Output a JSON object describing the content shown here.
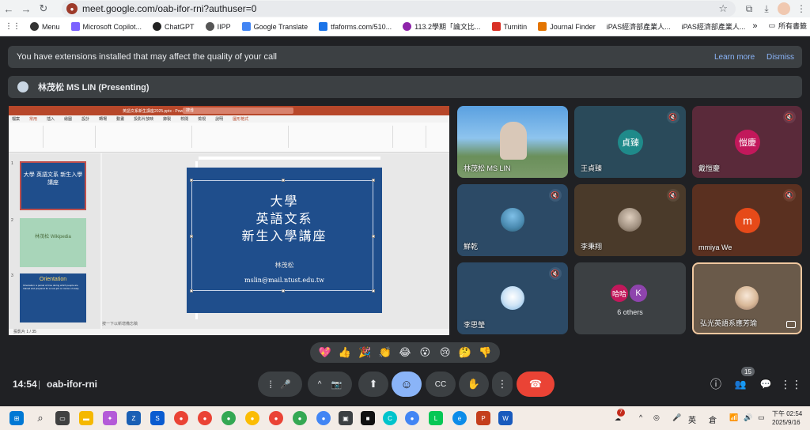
{
  "browser": {
    "url": "meet.google.com/oab-ifor-rni?authuser=0",
    "back_glyph": "←",
    "forward_glyph": "→",
    "reload_glyph": "↻",
    "star_glyph": "☆",
    "ext_glyph": "⧉",
    "dl_glyph": "⤓",
    "menu_glyph": "⋮",
    "apps_glyph": "⋮⋮",
    "bookmarks": [
      {
        "label": "Menu",
        "color": "#333333"
      },
      {
        "label": "Microsoft Copilot...",
        "color": "#7b61ff"
      },
      {
        "label": "ChatGPT",
        "color": "#222222"
      },
      {
        "label": "IIPP",
        "color": "#555555"
      },
      {
        "label": "Google Translate",
        "color": "#4285f4"
      },
      {
        "label": "tfaforms.com/510...",
        "color": "#1a73e8"
      },
      {
        "label": "113.2學期「論文比...",
        "color": "#8e24aa"
      },
      {
        "label": "Turnitin",
        "color": "#d93025"
      },
      {
        "label": "Journal Finder",
        "color": "#e37400"
      },
      {
        "label": "iPAS經濟部產業人...",
        "color": "#c2185b"
      },
      {
        "label": "iPAS經濟部產業人...",
        "color": "#c2185b"
      }
    ],
    "bookmarks_more": "»",
    "all_bookmarks": "所有書籤"
  },
  "banner": {
    "text": "You have extensions installed that may affect the quality of your call",
    "learn_more": "Learn more",
    "dismiss": "Dismiss"
  },
  "presenting": {
    "label": "林茂松 MS LIN (Presenting)"
  },
  "slide": {
    "title_lines": [
      "大學",
      "英語文系",
      "新生入學講座"
    ],
    "author": "林茂松",
    "email": "mslin@mail.ntust.edu.tw"
  },
  "powerpoint": {
    "title": "英語文系新生講座2025.pptx - PowerPoint",
    "search_placeholder": "搜尋",
    "tabs": [
      "檔案",
      "常用",
      "插入",
      "繪圖",
      "設計",
      "轉場",
      "動畫",
      "投影片放映",
      "錄製",
      "校閱",
      "檢視",
      "說明",
      "圖形格式"
    ],
    "thumb1": "大學 英語文系 新生入學講座",
    "thumb2": "林茂松 Wikipedia",
    "thumb3_title": "Orientation",
    "thumb3_body": "Orientation: a period of time during which people are trained and prepared for a new job or course of study.",
    "status": "投影片 1 / 35",
    "notes_hint": "按一下以新增備忘稿"
  },
  "participants": [
    {
      "name": "林茂松 MS LIN",
      "type": "video",
      "muted": false
    },
    {
      "name": "王貞臻",
      "initials": "貞臻",
      "bg": "#2a4a5a",
      "avatar_color": "#1f8a8a",
      "muted": true
    },
    {
      "name": "戴愷慶",
      "initials": "愷慶",
      "bg": "#5a2a3a",
      "avatar_color": "#c2185b",
      "muted": true
    },
    {
      "name": "鮮乾",
      "bg": "#2c4a66",
      "muted": true
    },
    {
      "name": "李秉翔",
      "bg": "#4a3a2a",
      "muted": true
    },
    {
      "name": "mmiya We",
      "initials": "m",
      "bg": "#5a3020",
      "avatar_color": "#e64a19",
      "muted": true
    },
    {
      "name": "李思瑩",
      "bg": "#2c4a66",
      "muted": true
    },
    {
      "name": "6 others",
      "initials_a": "哈哈",
      "initials_b": "K",
      "bg": "#3c4043",
      "muted": false
    },
    {
      "name": "弘光英語系應芳瑜",
      "bg": "#6a5a4a",
      "muted": false
    }
  ],
  "reactions": [
    "💖",
    "👍",
    "🎉",
    "👏",
    "😂",
    "😮",
    "😢",
    "🤔",
    "👎"
  ],
  "controls": {
    "time": "14:54",
    "separator": "|",
    "meeting_code": "oab-ifor-rni",
    "mic_glyph": "🎤",
    "camera_glyph": "📷",
    "present_glyph": "⬆",
    "emoji_glyph": "☺",
    "cc_glyph": "CC",
    "hand_glyph": "✋",
    "more_glyph": "⋮",
    "end_glyph": "☎",
    "caret_glyph": "^",
    "bars_glyph": "⁞",
    "info_glyph": "ⓘ",
    "people_glyph": "👥",
    "chat_glyph": "💬",
    "activities_glyph": "⋮⋮",
    "people_count": "15"
  },
  "taskbar": {
    "notification_badge": "7",
    "ime_lang": "英",
    "ime_mode": "倉",
    "time": "下午 02:54",
    "date": "2025/9/16"
  },
  "colors": {
    "meet_bg": "#202124",
    "accent": "#8ab4f8",
    "end_call": "#ea4335",
    "slide_blue": "#1f4e8c",
    "ppt_red": "#b7472a"
  }
}
